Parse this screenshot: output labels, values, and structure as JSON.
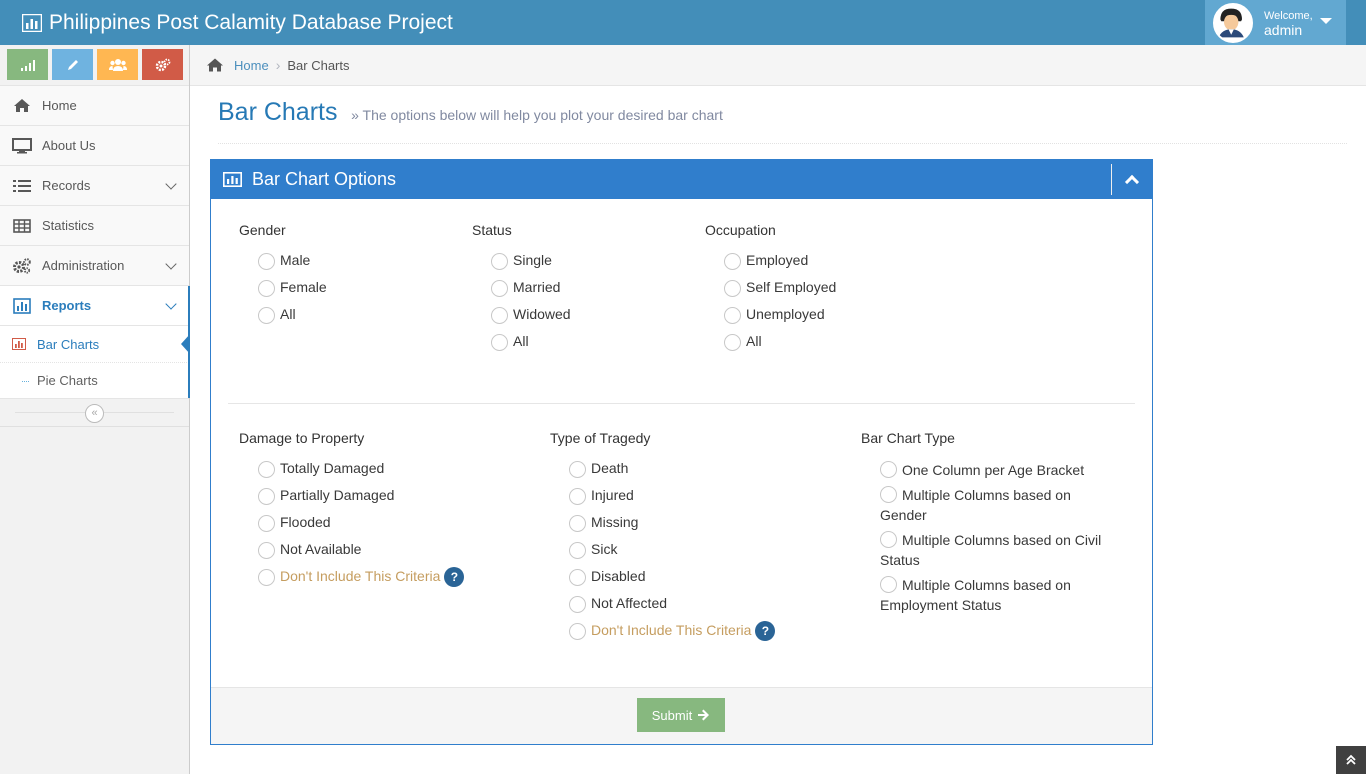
{
  "app": {
    "title": "Philippines Post Calamity Database Project",
    "user": {
      "greeting": "Welcome,",
      "name": "admin"
    }
  },
  "sidebar": {
    "items": [
      {
        "label": "Home"
      },
      {
        "label": "About Us"
      },
      {
        "label": "Records"
      },
      {
        "label": "Statistics"
      },
      {
        "label": "Administration"
      },
      {
        "label": "Reports"
      }
    ],
    "reports_sub": [
      {
        "label": "Bar Charts"
      },
      {
        "label": "Pie Charts"
      }
    ]
  },
  "breadcrumb": {
    "home": "Home",
    "current": "Bar Charts"
  },
  "page": {
    "title": "Bar Charts",
    "subtitle": "» The options below will help you plot your desired bar chart"
  },
  "widget": {
    "title": "Bar Chart Options",
    "groups": {
      "gender": {
        "label": "Gender",
        "options": [
          "Male",
          "Female",
          "All"
        ]
      },
      "status": {
        "label": "Status",
        "options": [
          "Single",
          "Married",
          "Widowed",
          "All"
        ]
      },
      "occupation": {
        "label": "Occupation",
        "options": [
          "Employed",
          "Self Employed",
          "Unemployed",
          "All"
        ]
      },
      "damage": {
        "label": "Damage to Property",
        "options": [
          "Totally Damaged",
          "Partially Damaged",
          "Flooded",
          "Not Available",
          "Don't Include This Criteria"
        ]
      },
      "tragedy": {
        "label": "Type of Tragedy",
        "options": [
          "Death",
          "Injured",
          "Missing",
          "Sick",
          "Disabled",
          "Not Affected",
          "Don't Include This Criteria"
        ]
      },
      "chart_type": {
        "label": "Bar Chart Type",
        "options": [
          "One Column per Age Bracket",
          "Multiple Columns based on Gender",
          "Multiple Columns based on Civil Status",
          "Multiple Columns based on Employment Status"
        ]
      }
    },
    "help_symbol": "?",
    "submit_label": "Submit"
  },
  "colors": {
    "navbar": "#438eb9",
    "accent": "#307ecc",
    "exclude_text": "#c59d5f",
    "submit": "#87b87f"
  }
}
